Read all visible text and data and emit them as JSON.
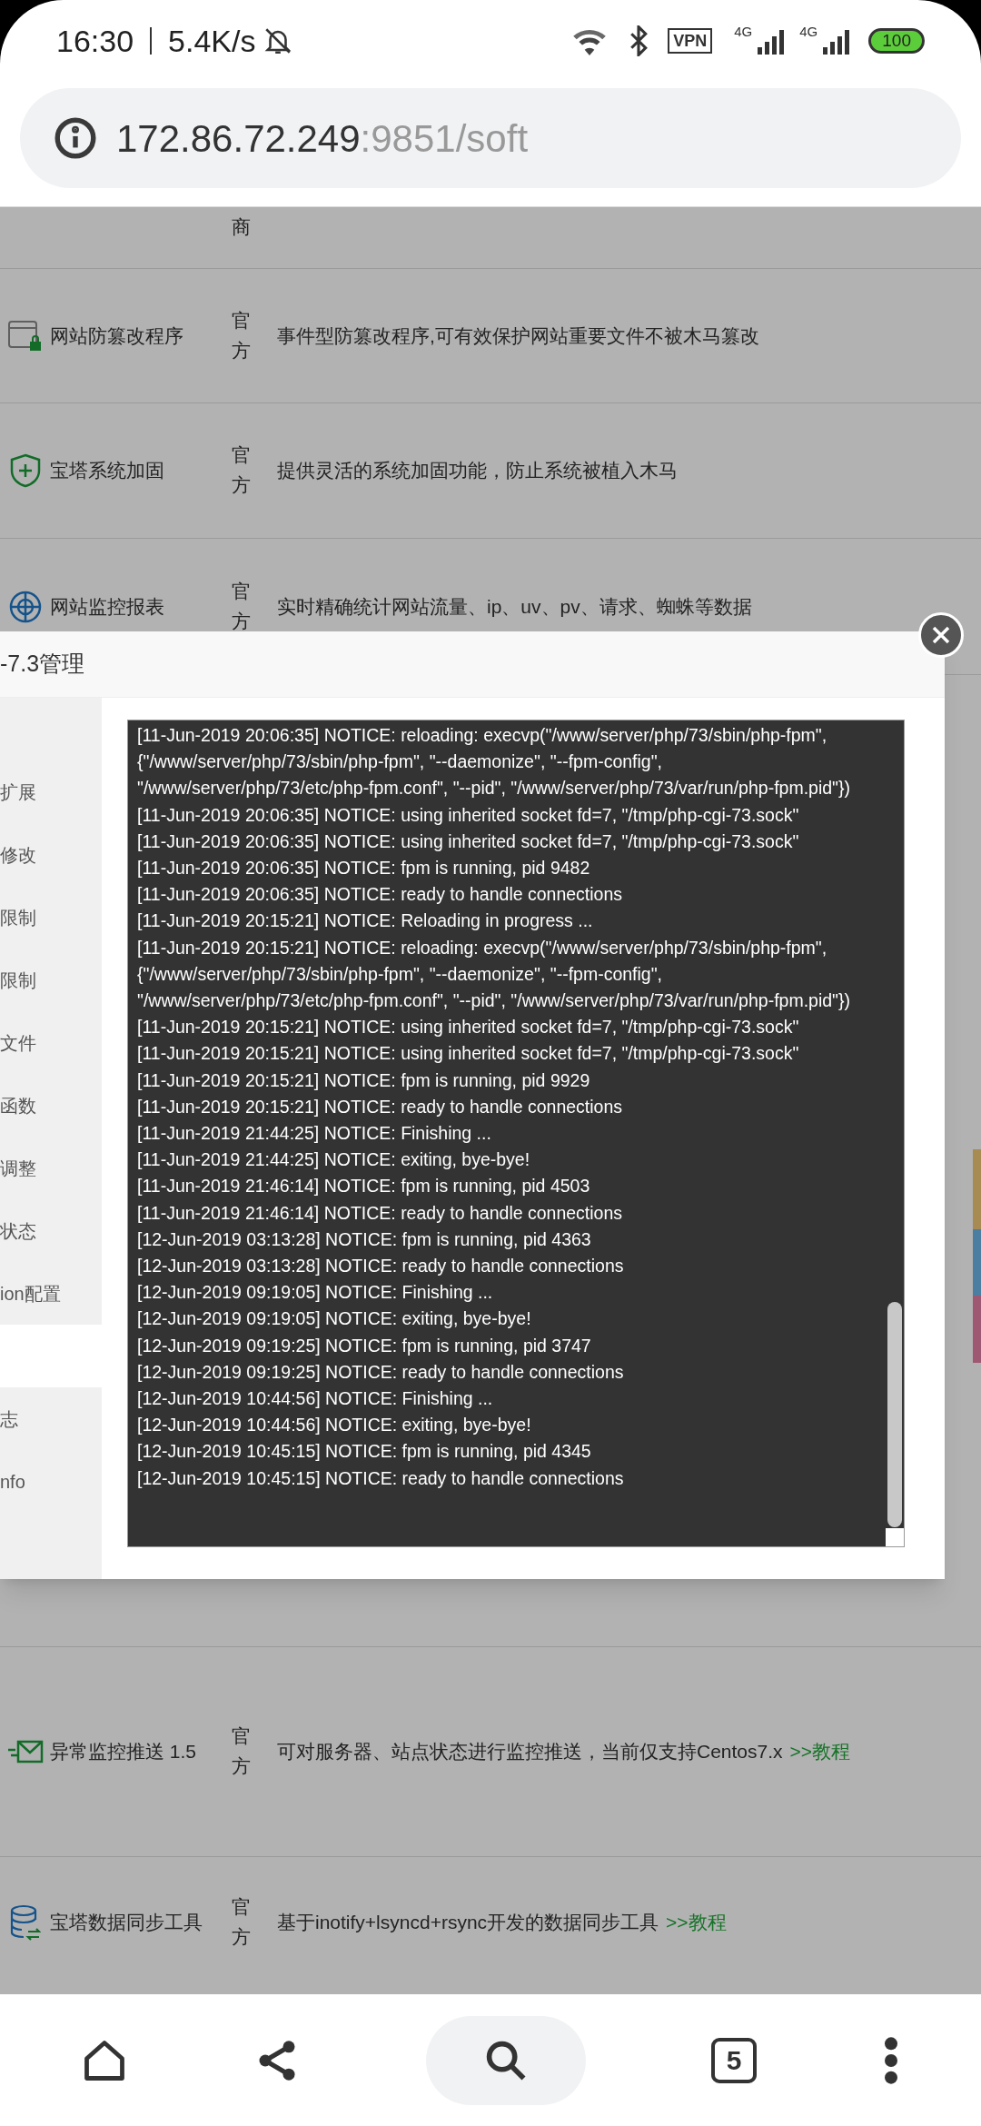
{
  "status_bar": {
    "time": "16:30",
    "speed": "5.4K/s",
    "vpn": "VPN",
    "sim_1": "4G",
    "sim_2": "4G",
    "battery": "100"
  },
  "address_bar": {
    "host": "172.86.72.249",
    "path": ":9851/soft"
  },
  "rows_above": [
    {
      "vendor": "商"
    },
    {
      "kind": "window-lock",
      "name": "网站防篡改程序",
      "vendor": "官方",
      "description": "事件型防篡改程序,可有效保护网站重要文件不被木马篡改"
    },
    {
      "kind": "shield",
      "name": "宝塔系统加固",
      "vendor": "官方",
      "description": "提供灵活的系统加固功能，防止系统被植入木马"
    },
    {
      "kind": "target",
      "name": "网站监控报表",
      "vendor": "官方",
      "description": "实时精确统计网站流量、ip、uv、pv、请求、蜘蛛等数据"
    }
  ],
  "modal": {
    "title": "-7.3管理",
    "sidebar": [
      {
        "label": "扩展",
        "selected": false
      },
      {
        "label": "修改",
        "selected": false
      },
      {
        "label": "限制",
        "selected": false
      },
      {
        "label": "限制",
        "selected": false
      },
      {
        "label": "文件",
        "selected": false
      },
      {
        "label": "函数",
        "selected": false
      },
      {
        "label": "调整",
        "selected": false
      },
      {
        "label": "状态",
        "selected": false
      },
      {
        "label": "ion配置",
        "selected": false
      },
      {
        "selected": true
      },
      {
        "label": "志",
        "selected": false
      },
      {
        "label": "nfo",
        "selected": false
      }
    ],
    "log": [
      "[11-Jun-2019 20:06:35] NOTICE: reloading: execvp(\"/www/server/php/73/sbin/php-fpm\", {\"/www/server/php/73/sbin/php-fpm\", \"--daemonize\", \"--fpm-config\", \"/www/server/php/73/etc/php-fpm.conf\", \"--pid\", \"/www/server/php/73/var/run/php-fpm.pid\"})",
      "[11-Jun-2019 20:06:35] NOTICE: using inherited socket fd=7, \"/tmp/php-cgi-73.sock\"",
      "[11-Jun-2019 20:06:35] NOTICE: using inherited socket fd=7, \"/tmp/php-cgi-73.sock\"",
      "[11-Jun-2019 20:06:35] NOTICE: fpm is running, pid 9482",
      "[11-Jun-2019 20:06:35] NOTICE: ready to handle connections",
      "[11-Jun-2019 20:15:21] NOTICE: Reloading in progress ...",
      "[11-Jun-2019 20:15:21] NOTICE: reloading: execvp(\"/www/server/php/73/sbin/php-fpm\", {\"/www/server/php/73/sbin/php-fpm\", \"--daemonize\", \"--fpm-config\", \"/www/server/php/73/etc/php-fpm.conf\", \"--pid\", \"/www/server/php/73/var/run/php-fpm.pid\"})",
      "[11-Jun-2019 20:15:21] NOTICE: using inherited socket fd=7, \"/tmp/php-cgi-73.sock\"",
      "[11-Jun-2019 20:15:21] NOTICE: using inherited socket fd=7, \"/tmp/php-cgi-73.sock\"",
      "[11-Jun-2019 20:15:21] NOTICE: fpm is running, pid 9929",
      "[11-Jun-2019 20:15:21] NOTICE: ready to handle connections",
      "[11-Jun-2019 21:44:25] NOTICE: Finishing ...",
      "[11-Jun-2019 21:44:25] NOTICE: exiting, bye-bye!",
      "[11-Jun-2019 21:46:14] NOTICE: fpm is running, pid 4503",
      "[11-Jun-2019 21:46:14] NOTICE: ready to handle connections",
      "[12-Jun-2019 03:13:28] NOTICE: fpm is running, pid 4363",
      "[12-Jun-2019 03:13:28] NOTICE: ready to handle connections",
      "[12-Jun-2019 09:19:05] NOTICE: Finishing ...",
      "[12-Jun-2019 09:19:05] NOTICE: exiting, bye-bye!",
      "[12-Jun-2019 09:19:25] NOTICE: fpm is running, pid 3747",
      "[12-Jun-2019 09:19:25] NOTICE: ready to handle connections",
      "[12-Jun-2019 10:44:56] NOTICE: Finishing ...",
      "[12-Jun-2019 10:44:56] NOTICE: exiting, bye-bye!",
      "[12-Jun-2019 10:45:15] NOTICE: fpm is running, pid 4345",
      "[12-Jun-2019 10:45:15] NOTICE: ready to handle connections"
    ]
  },
  "rows_below": [
    {
      "kind": "mail",
      "name": "异常监控推送 1.5",
      "vendor": "官方",
      "description": "可对服务器、站点状态进行监控推送，当前仅支持Centos7.x",
      "link": ">>教程"
    },
    {
      "kind": "database",
      "name": "宝塔数据同步工具",
      "vendor": "官方",
      "description": "基于inotify+lsyncd+rsync开发的数据同步工具",
      "link": ">>教程"
    }
  ],
  "bottom_nav": {
    "tabs_count": "5"
  }
}
